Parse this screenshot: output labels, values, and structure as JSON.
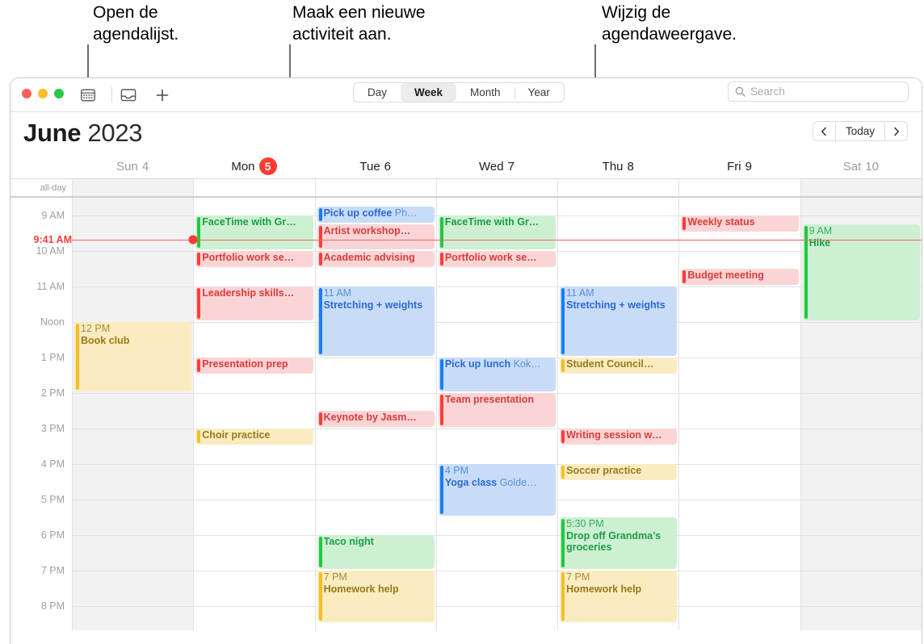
{
  "callouts": [
    {
      "text": "Open de\nagendalijst.",
      "target": "calendar-list-button"
    },
    {
      "text": "Maak een nieuwe\nactiviteit aan.",
      "target": "new-event-button"
    },
    {
      "text": "Wijzig de\nagendaweergave.",
      "target": "view-segmented-control"
    }
  ],
  "toolbar": {
    "calendar_list_icon": "calendar-icon",
    "inbox_icon": "inbox-tray-icon",
    "add_icon": "plus-icon",
    "views": [
      {
        "label": "Day",
        "active": false
      },
      {
        "label": "Week",
        "active": true
      },
      {
        "label": "Month",
        "active": false
      },
      {
        "label": "Year",
        "active": false
      }
    ],
    "search": {
      "placeholder": "Search",
      "value": "",
      "icon": "search-icon"
    }
  },
  "header": {
    "month": "June",
    "year": "2023",
    "prev_label": "‹",
    "today_label": "Today",
    "next_label": "›"
  },
  "allday_label": "all-day",
  "days": [
    {
      "name": "Sun",
      "num": "4",
      "weekend": true,
      "today": false
    },
    {
      "name": "Mon",
      "num": "5",
      "weekend": false,
      "today": true
    },
    {
      "name": "Tue",
      "num": "6",
      "weekend": false,
      "today": false
    },
    {
      "name": "Wed",
      "num": "7",
      "weekend": false,
      "today": false
    },
    {
      "name": "Thu",
      "num": "8",
      "weekend": false,
      "today": false
    },
    {
      "name": "Fri",
      "num": "9",
      "weekend": false,
      "today": false
    },
    {
      "name": "Sat",
      "num": "10",
      "weekend": true,
      "today": false
    }
  ],
  "hours": [
    {
      "label": "9 AM",
      "hour": 9
    },
    {
      "label": "10 AM",
      "hour": 10
    },
    {
      "label": "11 AM",
      "hour": 11
    },
    {
      "label": "Noon",
      "hour": 12
    },
    {
      "label": "1 PM",
      "hour": 13
    },
    {
      "label": "2 PM",
      "hour": 14
    },
    {
      "label": "3 PM",
      "hour": 15
    },
    {
      "label": "4 PM",
      "hour": 16
    },
    {
      "label": "5 PM",
      "hour": 17
    },
    {
      "label": "6 PM",
      "hour": 18
    },
    {
      "label": "7 PM",
      "hour": 19
    },
    {
      "label": "8 PM",
      "hour": 20
    }
  ],
  "now": {
    "label": "9:41 AM",
    "hour": 9,
    "minute": 41,
    "day_index": 1
  },
  "colors": {
    "red": "#fc3d39",
    "blue": "#1a7ef0",
    "green": "#20c93f",
    "yellow": "#f6bd28",
    "accent_today": "#ff3b30",
    "now_line": "#f6635c"
  },
  "events": [
    {
      "day": 0,
      "start": 12.0,
      "end": 14.0,
      "color": "yellow",
      "time": "12 PM",
      "title": "Book club",
      "loc": "",
      "stacked": true
    },
    {
      "day": 1,
      "start": 9.0,
      "end": 10.0,
      "color": "green",
      "time": "",
      "title": "FaceTime with Gr…",
      "loc": "",
      "stacked": false
    },
    {
      "day": 1,
      "start": 10.0,
      "end": 10.5,
      "color": "red",
      "time": "",
      "title": "Portfolio work se…",
      "loc": "",
      "stacked": false
    },
    {
      "day": 1,
      "start": 11.0,
      "end": 12.0,
      "color": "red",
      "time": "",
      "title": "Leadership skills…",
      "loc": "",
      "stacked": false
    },
    {
      "day": 1,
      "start": 13.0,
      "end": 13.5,
      "color": "red",
      "time": "",
      "title": "Presentation prep",
      "loc": "",
      "stacked": false
    },
    {
      "day": 1,
      "start": 15.0,
      "end": 15.5,
      "color": "yellow",
      "time": "",
      "title": "Choir practice",
      "loc": "",
      "stacked": false
    },
    {
      "day": 2,
      "start": 8.75,
      "end": 9.25,
      "color": "blue",
      "time": "",
      "title": "Pick up coffee",
      "loc": "Ph…",
      "stacked": false
    },
    {
      "day": 2,
      "start": 9.25,
      "end": 10.0,
      "color": "red",
      "time": "",
      "title": "Artist workshop…",
      "loc": "",
      "stacked": false
    },
    {
      "day": 2,
      "start": 10.0,
      "end": 10.5,
      "color": "red",
      "time": "",
      "title": "Academic advising",
      "loc": "",
      "stacked": false
    },
    {
      "day": 2,
      "start": 11.0,
      "end": 13.0,
      "color": "blue",
      "time": "11 AM",
      "title": "Stretching + weights",
      "loc": "",
      "stacked": true
    },
    {
      "day": 2,
      "start": 14.5,
      "end": 15.0,
      "color": "red",
      "time": "",
      "title": "Keynote by Jasm…",
      "loc": "",
      "stacked": false
    },
    {
      "day": 2,
      "start": 18.0,
      "end": 19.0,
      "color": "green",
      "time": "",
      "title": "Taco night",
      "loc": "",
      "stacked": false
    },
    {
      "day": 2,
      "start": 19.0,
      "end": 20.5,
      "color": "yellow",
      "time": "7 PM",
      "title": "Homework help",
      "loc": "",
      "stacked": true
    },
    {
      "day": 3,
      "start": 9.0,
      "end": 10.0,
      "color": "green",
      "time": "",
      "title": "FaceTime with Gr…",
      "loc": "",
      "stacked": false
    },
    {
      "day": 3,
      "start": 10.0,
      "end": 10.5,
      "color": "red",
      "time": "",
      "title": "Portfolio work se…",
      "loc": "",
      "stacked": false
    },
    {
      "day": 3,
      "start": 13.0,
      "end": 14.0,
      "color": "blue",
      "time": "",
      "title": "Pick up lunch",
      "loc": "Kok…",
      "stacked": false
    },
    {
      "day": 3,
      "start": 14.0,
      "end": 15.0,
      "color": "red",
      "time": "",
      "title": "Team presentation",
      "loc": "",
      "stacked": false
    },
    {
      "day": 3,
      "start": 16.0,
      "end": 17.5,
      "color": "blue",
      "time": "4 PM",
      "title": "Yoga class",
      "loc": "Golde…",
      "stacked": true
    },
    {
      "day": 4,
      "start": 11.0,
      "end": 13.0,
      "color": "blue",
      "time": "11 AM",
      "title": "Stretching + weights",
      "loc": "",
      "stacked": true
    },
    {
      "day": 4,
      "start": 13.0,
      "end": 13.5,
      "color": "yellow",
      "time": "",
      "title": "Student Council…",
      "loc": "",
      "stacked": false
    },
    {
      "day": 4,
      "start": 15.0,
      "end": 15.5,
      "color": "red",
      "time": "",
      "title": "Writing session w…",
      "loc": "",
      "stacked": false
    },
    {
      "day": 4,
      "start": 16.0,
      "end": 16.5,
      "color": "yellow",
      "time": "",
      "title": "Soccer practice",
      "loc": "",
      "stacked": false
    },
    {
      "day": 4,
      "start": 17.5,
      "end": 19.0,
      "color": "green",
      "time": "5:30 PM",
      "title": "Drop off Grandma’s groceries",
      "loc": "",
      "stacked": true
    },
    {
      "day": 4,
      "start": 19.0,
      "end": 20.5,
      "color": "yellow",
      "time": "7 PM",
      "title": "Homework help",
      "loc": "",
      "stacked": true
    },
    {
      "day": 5,
      "start": 9.0,
      "end": 9.5,
      "color": "red",
      "time": "",
      "title": "Weekly status",
      "loc": "",
      "stacked": false
    },
    {
      "day": 5,
      "start": 10.5,
      "end": 11.0,
      "color": "red",
      "time": "",
      "title": "Budget meeting",
      "loc": "",
      "stacked": false
    },
    {
      "day": 6,
      "start": 9.25,
      "end": 12.0,
      "color": "green",
      "time": "9 AM",
      "title": "Hike",
      "loc": "",
      "stacked": true
    }
  ]
}
